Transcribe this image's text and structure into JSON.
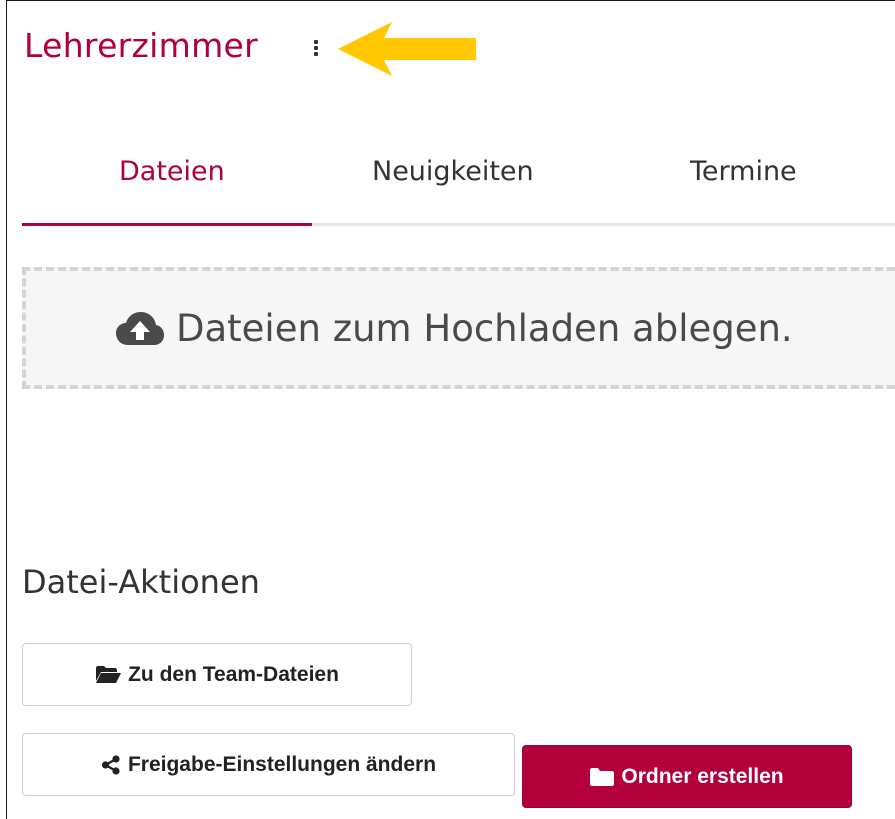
{
  "header": {
    "title": "Lehrerzimmer",
    "menu_icon": "kebab-menu-icon",
    "annotation_icon": "arrow-left-icon",
    "annotation_color": "#ffc800"
  },
  "tabs": [
    {
      "label": "Dateien",
      "active": true
    },
    {
      "label": "Neuigkeiten",
      "active": false
    },
    {
      "label": "Termine",
      "active": false
    }
  ],
  "dropzone": {
    "icon": "cloud-upload-icon",
    "text": "Dateien zum Hochladen ablegen."
  },
  "actions": {
    "title": "Datei-Aktionen",
    "team_files_label": "Zu den Team-Dateien",
    "team_files_icon": "folder-open-icon",
    "share_settings_label": "Freigabe-Einstellungen ändern",
    "share_settings_icon": "share-icon",
    "create_folder_label": "Ordner erstellen",
    "create_folder_icon": "folder-icon"
  },
  "colors": {
    "accent": "#b1003a",
    "tab_border": "#e6e6e6",
    "dropzone_bg": "#f6f6f6"
  }
}
